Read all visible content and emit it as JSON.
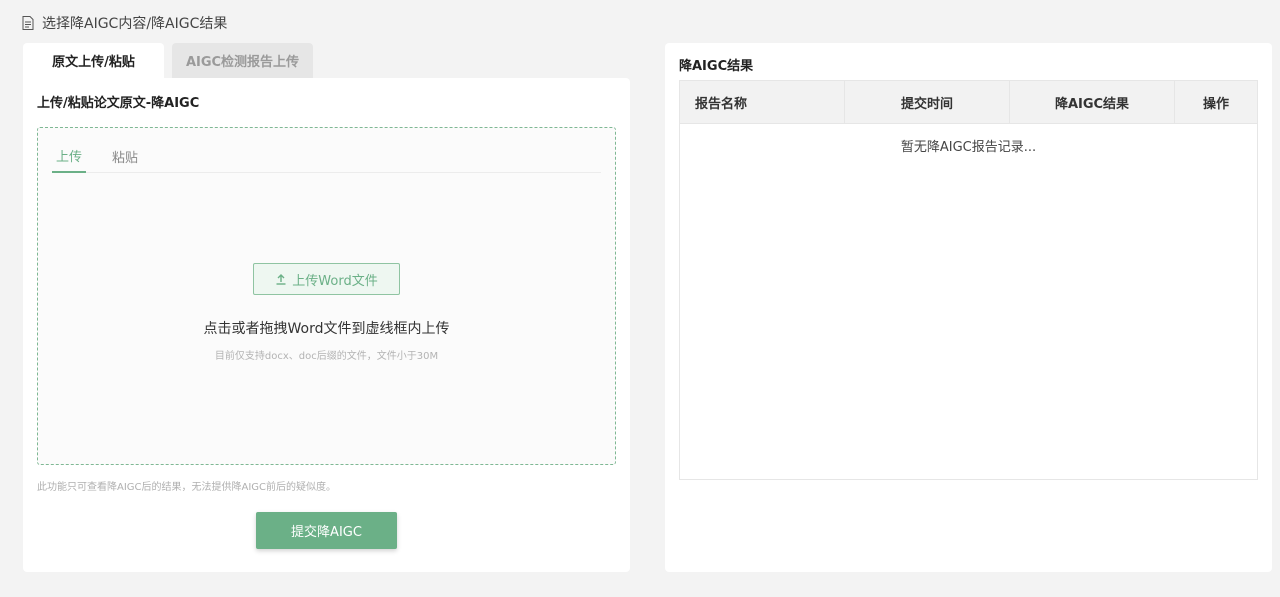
{
  "header": {
    "title": "选择降AIGC内容/降AIGC结果",
    "icon": "document-icon"
  },
  "left": {
    "tabs": [
      {
        "label": "原文上传/粘贴",
        "active": true
      },
      {
        "label": "AIGC检测报告上传",
        "active": false
      }
    ],
    "title": "上传/粘贴论文原文-降AIGC",
    "inner_tabs": [
      {
        "label": "上传",
        "active": true
      },
      {
        "label": "粘贴",
        "active": false
      }
    ],
    "upload_button": "上传Word文件",
    "upload_hint": "点击或者拖拽Word文件到虚线框内上传",
    "upload_sub": "目前仅支持docx、doc后缀的文件，文件小于30M",
    "notice": "此功能只可查看降AIGC后的结果，无法提供降AIGC前后的疑似度。",
    "submit_button": "提交降AIGC"
  },
  "right": {
    "title": "降AIGC结果",
    "columns": [
      "报告名称",
      "提交时间",
      "降AIGC结果",
      "操作"
    ],
    "empty_text": "暂无降AIGC报告记录..."
  },
  "colors": {
    "accent": "#6bb087",
    "border_dashed": "#7fb894"
  }
}
